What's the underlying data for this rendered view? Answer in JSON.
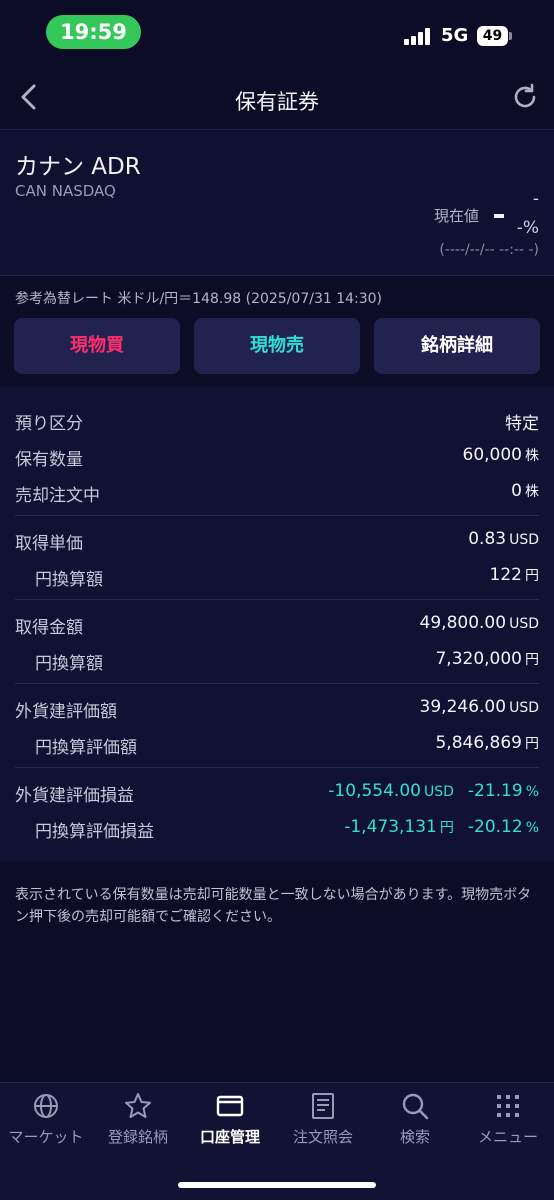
{
  "status_bar": {
    "time": "19:59",
    "network": "5G",
    "battery": "49"
  },
  "nav": {
    "title": "保有証券",
    "back_icon": "chevron-left-icon",
    "refresh_icon": "refresh-icon"
  },
  "stock": {
    "name": "カナン ADR",
    "code": "CAN NASDAQ",
    "price_label": "現在値",
    "price_dash": "-",
    "price_pct": "-%",
    "price_time": "(----/--/-- --:-- -)"
  },
  "fx_rate": "参考為替レート 米ドル/円＝148.98 (2025/07/31 14:30)",
  "actions": {
    "buy": "現物買",
    "sell": "現物売",
    "detail": "銘柄詳細"
  },
  "holdings": {
    "rows": [
      {
        "label": "預り区分",
        "value": "特定",
        "unit": ""
      },
      {
        "label": "保有数量",
        "value": "60,000",
        "unit": "株"
      },
      {
        "label": "売却注文中",
        "value": "0",
        "unit": "株"
      },
      {
        "label": "取得単価",
        "value": "0.83",
        "unit": "USD"
      },
      {
        "label": "円換算額",
        "value": "122",
        "unit": "円"
      },
      {
        "label": "取得金額",
        "value": "49,800.00",
        "unit": "USD"
      },
      {
        "label": "円換算額",
        "value": "7,320,000",
        "unit": "円"
      },
      {
        "label": "外貨建評価額",
        "value": "39,246.00",
        "unit": "USD"
      },
      {
        "label": "円換算評価額",
        "value": "5,846,869",
        "unit": "円"
      },
      {
        "label": "外貨建評価損益",
        "value": "-10,554.00",
        "unit": "USD",
        "pct": "-21.19",
        "pct_unit": "%"
      },
      {
        "label": "円換算評価損益",
        "value": "-1,473,131",
        "unit": "円",
        "pct": "-20.12",
        "pct_unit": "%"
      }
    ]
  },
  "note": "表示されている保有数量は売却可能数量と一致しない場合があります。現物売ボタン押下後の売却可能額でご確認ください。",
  "tabs": [
    {
      "label": "マーケット",
      "icon": "globe-icon"
    },
    {
      "label": "登録銘柄",
      "icon": "star-icon"
    },
    {
      "label": "口座管理",
      "icon": "card-icon"
    },
    {
      "label": "注文照会",
      "icon": "document-icon"
    },
    {
      "label": "検索",
      "icon": "search-icon"
    },
    {
      "label": "メニュー",
      "icon": "grid-icon"
    }
  ],
  "colors": {
    "buy": "#ff2d6e",
    "sell": "#2ee0d4",
    "loss": "#2ee0d4",
    "accent_green": "#34c759"
  }
}
